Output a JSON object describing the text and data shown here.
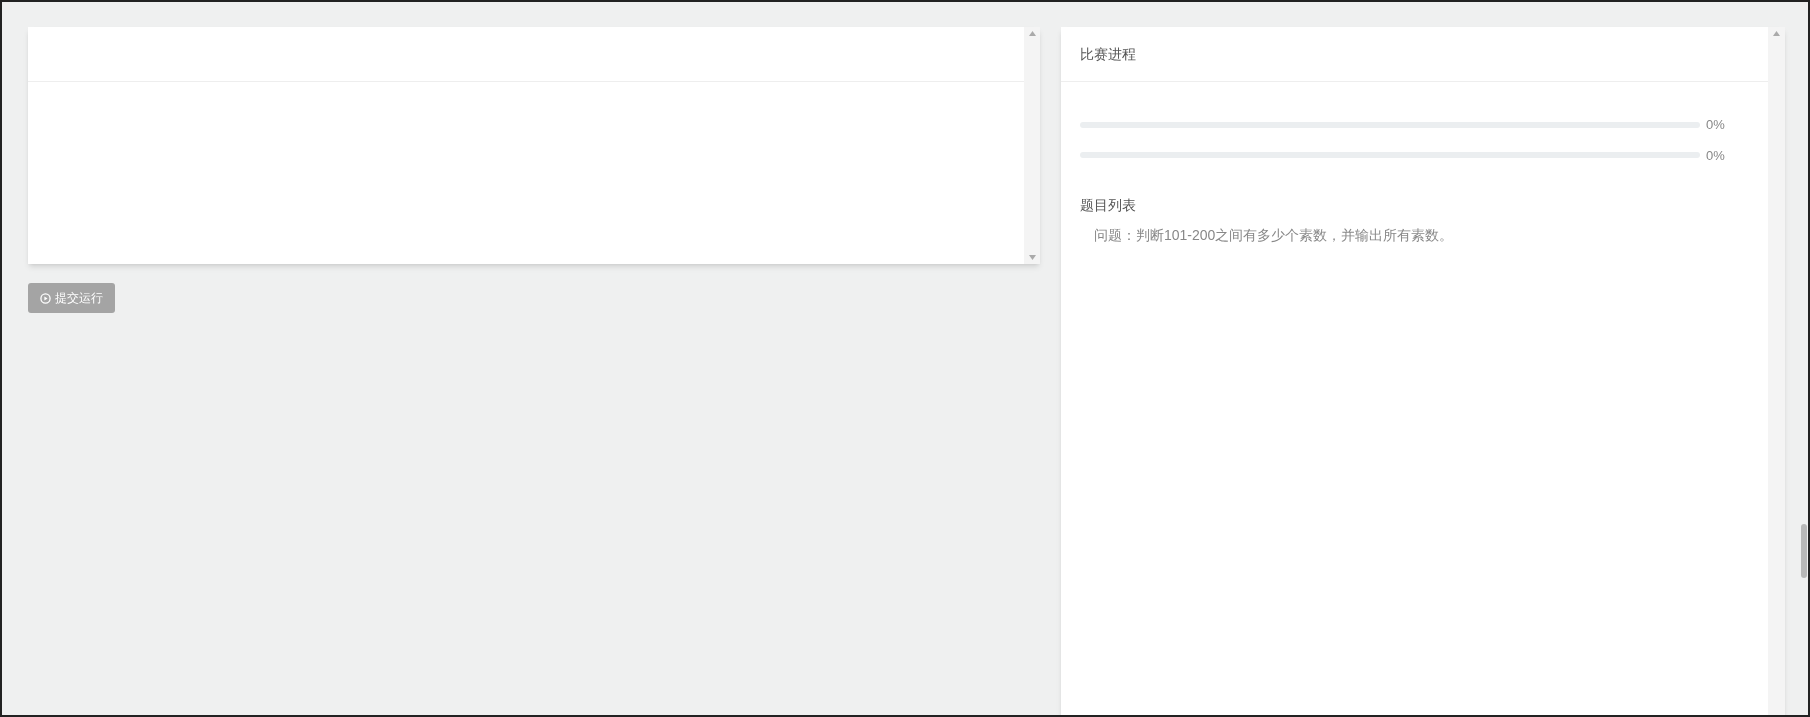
{
  "run_button": {
    "label": "提交运行",
    "disabled": true
  },
  "progress_panel": {
    "title": "比赛进程",
    "bars": [
      {
        "level": 0,
        "reading": "0%"
      },
      {
        "level": 0,
        "reading": "0%"
      }
    ],
    "list_title": "题目列表",
    "questions": [
      "问题：判断101-200之间有多少个素数，并输出所有素数。"
    ]
  }
}
